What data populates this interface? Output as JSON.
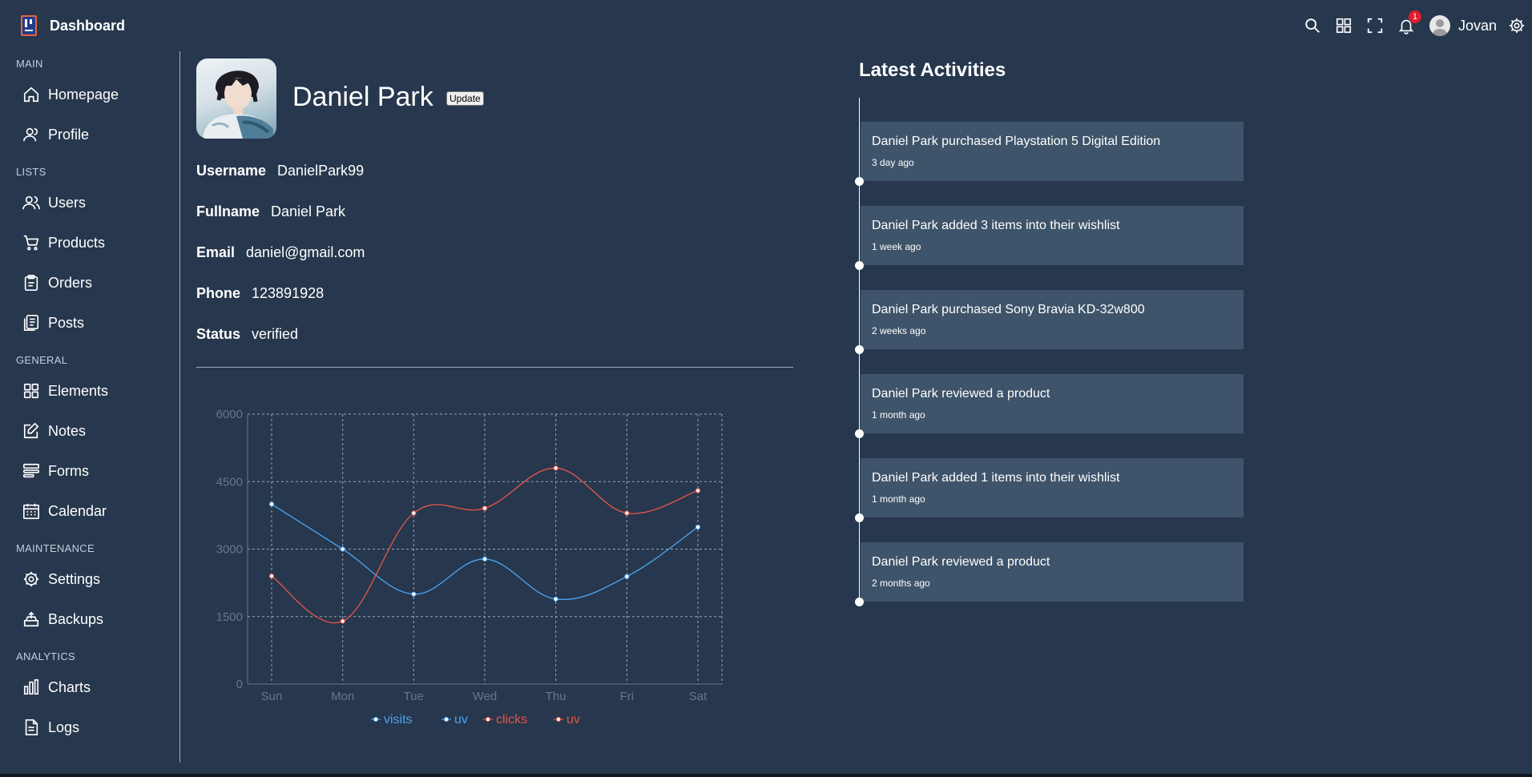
{
  "header": {
    "brand": "Dashboard",
    "notification_count": "1",
    "user_name": "Jovan",
    "icons": [
      "search-icon",
      "grid-icon",
      "fullscreen-icon",
      "bell-icon",
      "avatar",
      "gear-icon"
    ]
  },
  "sidebar": {
    "sections": [
      {
        "title": "MAIN",
        "items": [
          {
            "label": "Homepage",
            "icon": "home-icon"
          },
          {
            "label": "Profile",
            "icon": "user-icon"
          }
        ]
      },
      {
        "title": "LISTS",
        "items": [
          {
            "label": "Users",
            "icon": "users-icon"
          },
          {
            "label": "Products",
            "icon": "cart-icon"
          },
          {
            "label": "Orders",
            "icon": "clipboard-icon"
          },
          {
            "label": "Posts",
            "icon": "posts-icon"
          }
        ]
      },
      {
        "title": "GENERAL",
        "items": [
          {
            "label": "Elements",
            "icon": "elements-icon"
          },
          {
            "label": "Notes",
            "icon": "notes-icon"
          },
          {
            "label": "Forms",
            "icon": "forms-icon"
          },
          {
            "label": "Calendar",
            "icon": "calendar-icon"
          }
        ]
      },
      {
        "title": "MAINTENANCE",
        "items": [
          {
            "label": "Settings",
            "icon": "gear-icon"
          },
          {
            "label": "Backups",
            "icon": "backup-icon"
          }
        ]
      },
      {
        "title": "ANALYTICS",
        "items": [
          {
            "label": "Charts",
            "icon": "chart-icon"
          },
          {
            "label": "Logs",
            "icon": "logs-icon"
          }
        ]
      }
    ]
  },
  "profile": {
    "name": "Daniel Park",
    "update_label": "Update",
    "details": [
      {
        "key": "Username",
        "value": "DanielPark99"
      },
      {
        "key": "Fullname",
        "value": "Daniel Park"
      },
      {
        "key": "Email",
        "value": "daniel@gmail.com"
      },
      {
        "key": "Phone",
        "value": "123891928"
      },
      {
        "key": "Status",
        "value": "verified"
      }
    ]
  },
  "chart_data": {
    "type": "line",
    "categories": [
      "Sun",
      "Mon",
      "Tue",
      "Wed",
      "Thu",
      "Fri",
      "Sat"
    ],
    "ylim": [
      0,
      6000
    ],
    "yticks": [
      0,
      1500,
      3000,
      4500,
      6000
    ],
    "grid": true,
    "legend_position": "bottom",
    "series": [
      {
        "name": "visits",
        "color": "#4aa3f0",
        "values": [
          4000,
          3000,
          2000,
          2780,
          1890,
          2390,
          3490
        ]
      },
      {
        "name": "uv",
        "color": "#4aa3f0",
        "values": [
          4000,
          3000,
          2000,
          2780,
          1890,
          2390,
          3490
        ]
      },
      {
        "name": "clicks",
        "color": "#e0564a",
        "values": [
          2400,
          1398,
          3800,
          3908,
          4800,
          3800,
          4300
        ]
      },
      {
        "name": "uv",
        "color": "#e0564a",
        "values": [
          2400,
          1398,
          3800,
          3908,
          4800,
          3800,
          4300
        ]
      }
    ]
  },
  "activities": {
    "title": "Latest Activities",
    "items": [
      {
        "text": "Daniel Park purchased Playstation 5 Digital Edition",
        "time": "3 day ago"
      },
      {
        "text": "Daniel Park added 3 items into their wishlist",
        "time": "1 week ago"
      },
      {
        "text": "Daniel Park purchased Sony Bravia KD-32w800",
        "time": "2 weeks ago"
      },
      {
        "text": "Daniel Park reviewed a product",
        "time": "1 month ago"
      },
      {
        "text": "Daniel Park added 1 items into their wishlist",
        "time": "1 month ago"
      },
      {
        "text": "Daniel Park reviewed a product",
        "time": "2 months ago"
      }
    ]
  }
}
